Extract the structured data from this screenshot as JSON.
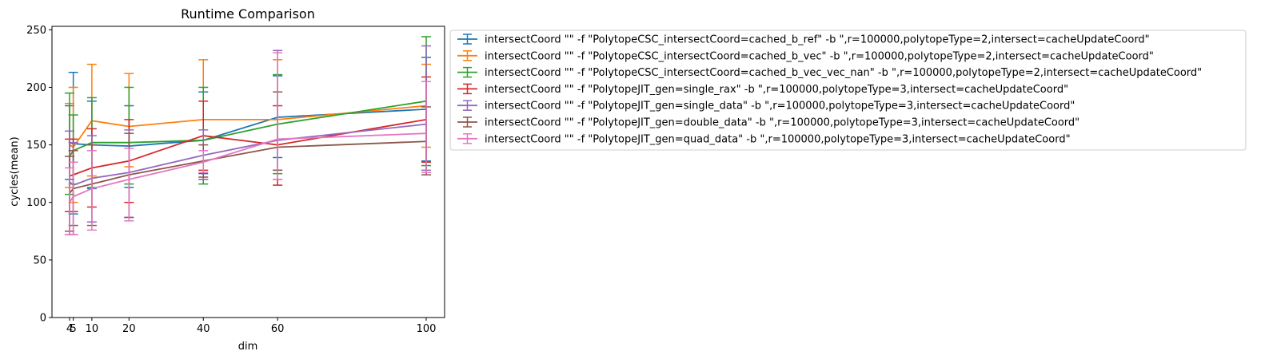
{
  "chart_data": {
    "type": "line",
    "title": "Runtime Comparison",
    "xlabel": "dim",
    "ylabel": "cycles(mean)",
    "xlim": [
      0,
      105
    ],
    "ylim": [
      0,
      253
    ],
    "xticks": [
      4,
      5,
      10,
      20,
      40,
      60,
      100
    ],
    "yticks": [
      0,
      50,
      100,
      150,
      200,
      250
    ],
    "x": [
      4,
      5,
      10,
      20,
      40,
      60,
      100
    ],
    "grid": false,
    "legend_position": "outside-right",
    "series": [
      {
        "name": "intersectCoord \"\" -f \"PolytopeCSC_intersectCoord=cached_b_ref\" -b \",r=100000,polytopeType=2,intersect=cacheUpdateCoord\"",
        "color": "#1f77b4",
        "values": [
          152,
          151,
          150,
          149,
          154,
          174,
          181
        ],
        "err_low": [
          120,
          90,
          112,
          113,
          125,
          139,
          136
        ],
        "err_high": [
          184,
          213,
          188,
          184,
          196,
          210,
          226
        ]
      },
      {
        "name": "intersectCoord \"\" -f \"PolytopeCSC_intersectCoord=cached_b_vec\" -b \",r=100000,polytopeType=2,intersect=cacheUpdateCoord\"",
        "color": "#ff7f0e",
        "values": [
          150,
          148,
          171,
          166,
          172,
          172,
          184
        ],
        "err_low": [
          113,
          100,
          123,
          131,
          120,
          120,
          148
        ],
        "err_high": [
          186,
          200,
          220,
          212,
          224,
          224,
          220
        ]
      },
      {
        "name": "intersectCoord \"\" -f \"PolytopeCSC_intersectCoord=cached_b_vec_vec_nan\" -b \",r=100000,polytopeType=2,intersect=cacheUpdateCoord\"",
        "color": "#2ca02c",
        "values": [
          140,
          145,
          152,
          152,
          154,
          168,
          188
        ],
        "err_low": [
          107,
          116,
          113,
          116,
          116,
          125,
          132
        ],
        "err_high": [
          195,
          176,
          191,
          200,
          200,
          211,
          244
        ]
      },
      {
        "name": "intersectCoord \"\" -f \"PolytopeJIT_gen=single_rax\" -b \",r=100000,polytopeType=3,intersect=cacheUpdateCoord\"",
        "color": "#d62728",
        "values": [
          123,
          124,
          130,
          136,
          158,
          150,
          172
        ],
        "err_low": [
          92,
          92,
          96,
          100,
          128,
          115,
          135
        ],
        "err_high": [
          155,
          155,
          164,
          172,
          188,
          184,
          209
        ]
      },
      {
        "name": "intersectCoord \"\" -f \"PolytopeJIT_gen=single_data\" -b \",r=100000,polytopeType=3,intersect=cacheUpdateCoord\"",
        "color": "#9467bd",
        "values": [
          118,
          115,
          121,
          126,
          141,
          154,
          168
        ],
        "err_low": [
          72,
          72,
          83,
          87,
          120,
          128,
          128
        ],
        "err_high": [
          162,
          152,
          158,
          163,
          163,
          232,
          236
        ]
      },
      {
        "name": "intersectCoord \"\" -f \"PolytopeJIT_gen=double_data\" -b \",r=100000,polytopeType=3,intersect=cacheUpdateCoord\"",
        "color": "#8c564b",
        "values": [
          108,
          112,
          116,
          124,
          136,
          148,
          153
        ],
        "err_low": [
          75,
          80,
          80,
          87,
          122,
          128,
          124
        ],
        "err_high": [
          140,
          145,
          150,
          160,
          150,
          196,
          183
        ]
      },
      {
        "name": "intersectCoord \"\" -f \"PolytopeJIT_gen=quad_data\" -b \",r=100000,polytopeType=3,intersect=cacheUpdateCoord\"",
        "color": "#e377c2",
        "values": [
          100,
          105,
          112,
          120,
          135,
          155,
          160
        ],
        "err_low": [
          72,
          72,
          76,
          84,
          126,
          120,
          126
        ],
        "err_high": [
          130,
          135,
          145,
          147,
          145,
          230,
          205
        ]
      }
    ]
  }
}
